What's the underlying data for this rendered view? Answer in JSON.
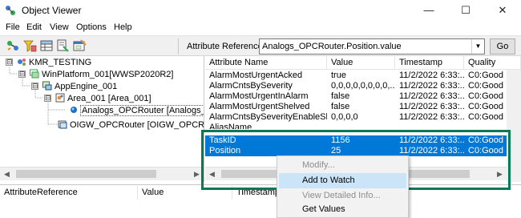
{
  "window": {
    "title": "Object Viewer",
    "controls": {
      "minimize": "—",
      "maximize": "☐",
      "close": "✕"
    }
  },
  "menu": [
    "File",
    "Edit",
    "View",
    "Options",
    "Help"
  ],
  "toolbar": {
    "icons": [
      "connect-icon",
      "filter-icon",
      "grid-view-icon",
      "properties-icon",
      "watch-window-icon"
    ],
    "attribute_reference_label": "Attribute Reference:",
    "attribute_reference_value": "Analogs_OPCRouter.Position.value",
    "go_label": "Go"
  },
  "tree": {
    "nodes": [
      {
        "label": "KMR_TESTING",
        "expander": "⊟"
      },
      {
        "label": "WinPlatform_001[WWSP2020R2]",
        "expander": "⊟"
      },
      {
        "label": "AppEngine_001",
        "expander": "⊟"
      },
      {
        "label": "Area_001 [Area_001]",
        "expander": "⊟"
      },
      {
        "label": "Analogs_OPCRouter [Analogs_OPCRouter]",
        "expander": ""
      },
      {
        "label": "OIGW_OPCRouter [OIGW_OPCRouter]",
        "expander": ""
      }
    ]
  },
  "attributes": {
    "columns": [
      "Attribute Name",
      "Value",
      "Timestamp",
      "Quality"
    ],
    "rows": [
      {
        "name": "AlarmMostUrgentAcked",
        "value": "true",
        "timestamp": "11/2/2022 6:33:...",
        "quality": "C0:Good",
        "selected": false
      },
      {
        "name": "AlarmCntsBySeverity",
        "value": "0,0,0,0,0,0,0,0,...",
        "timestamp": "11/2/2022 6:33:...",
        "quality": "C0:Good",
        "selected": false
      },
      {
        "name": "AlarmMostUrgentInAlarm",
        "value": "false",
        "timestamp": "11/2/2022 6:33:...",
        "quality": "C0:Good",
        "selected": false
      },
      {
        "name": "AlarmMostUrgentShelved",
        "value": "false",
        "timestamp": "11/2/2022 6:33:...",
        "quality": "C0:Good",
        "selected": false
      },
      {
        "name": "AlarmCntsBySeverityEnableShe...",
        "value": "0,0,0,0",
        "timestamp": "11/2/2022 6:33:...",
        "quality": "C0:Good",
        "selected": false
      },
      {
        "name": "AliasName",
        "value": "",
        "timestamp": "",
        "quality": "",
        "selected": false
      },
      {
        "name": "TaskID",
        "value": "1156",
        "timestamp": "11/2/2022 6:33:...",
        "quality": "C0:Good",
        "selected": true
      },
      {
        "name": "Position",
        "value": "25",
        "timestamp": "11/2/2022 6:33:...",
        "quality": "C0:Good",
        "selected": true
      }
    ]
  },
  "watch": {
    "columns": [
      "AttributeReference",
      "Value",
      "Timestamp"
    ]
  },
  "context_menu": {
    "items": [
      {
        "label": "Modify...",
        "disabled": true
      },
      {
        "label": "Add to Watch",
        "disabled": false,
        "hover": true
      },
      {
        "label": "View Detailed Info...",
        "disabled": true
      },
      {
        "label": "Get Values",
        "disabled": false
      }
    ]
  },
  "colors": {
    "selection": "#0078d7",
    "highlight_frame": "#0a7a56",
    "menu_hover": "#cce4f7"
  }
}
